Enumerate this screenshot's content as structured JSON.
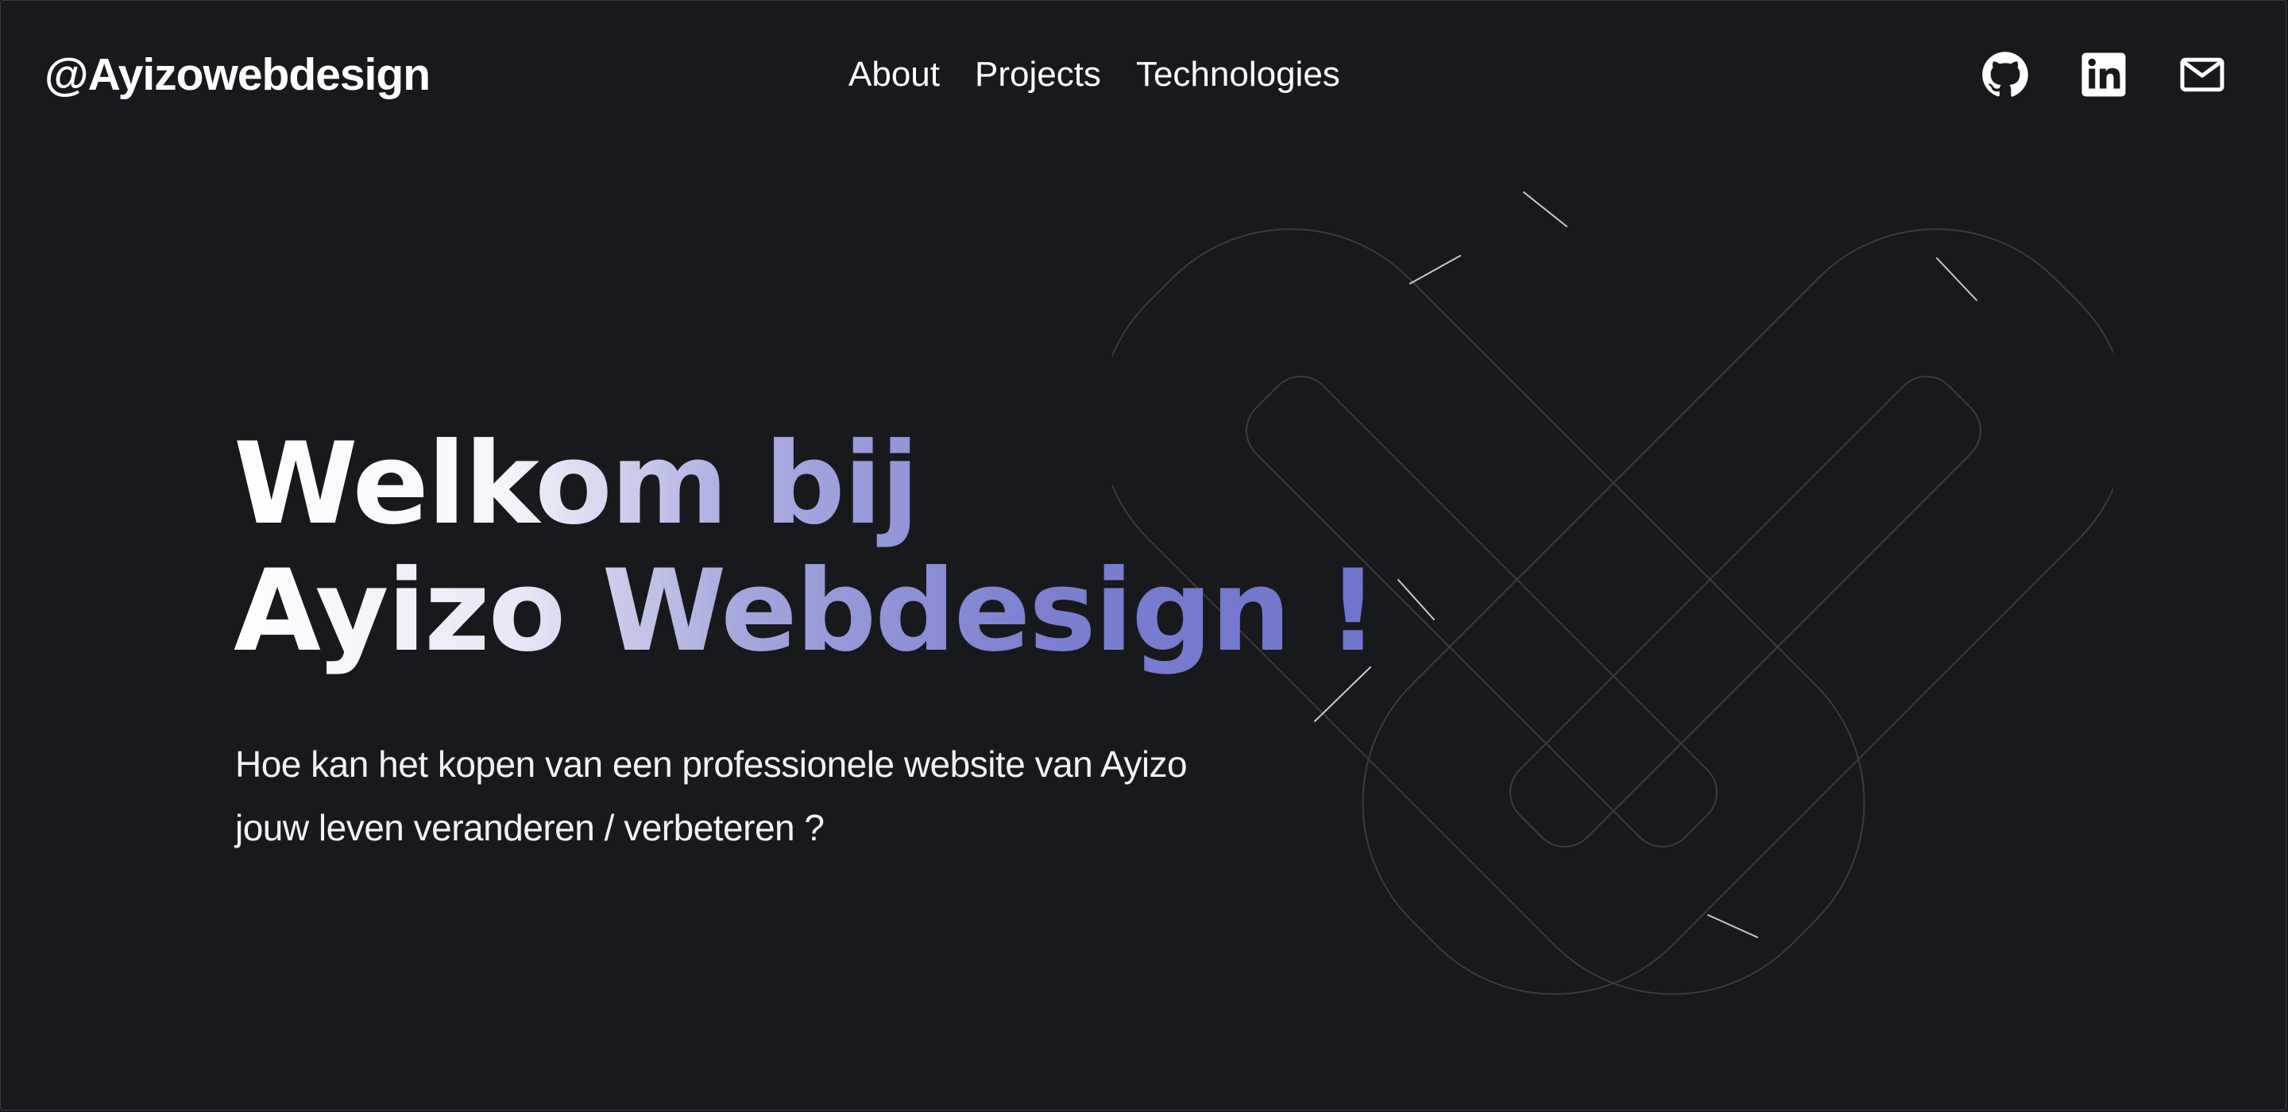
{
  "header": {
    "brand": "@Ayizowebdesign",
    "nav": [
      "About",
      "Projects",
      "Technologies"
    ],
    "socials": [
      "github-icon",
      "linkedin-icon",
      "mail-icon"
    ]
  },
  "hero": {
    "title_line1_a": "Welkom ",
    "title_line1_b": "bij",
    "title_line2_a": "Ayizo ",
    "title_line2_b": "Webdesign !",
    "subtitle": "Hoe kan het kopen van een professionele website van Ayizo jouw leven veranderen / verbeteren ?"
  },
  "colors": {
    "background": "#18191d",
    "accent": "#6f74cc",
    "text": "#ffffff"
  }
}
